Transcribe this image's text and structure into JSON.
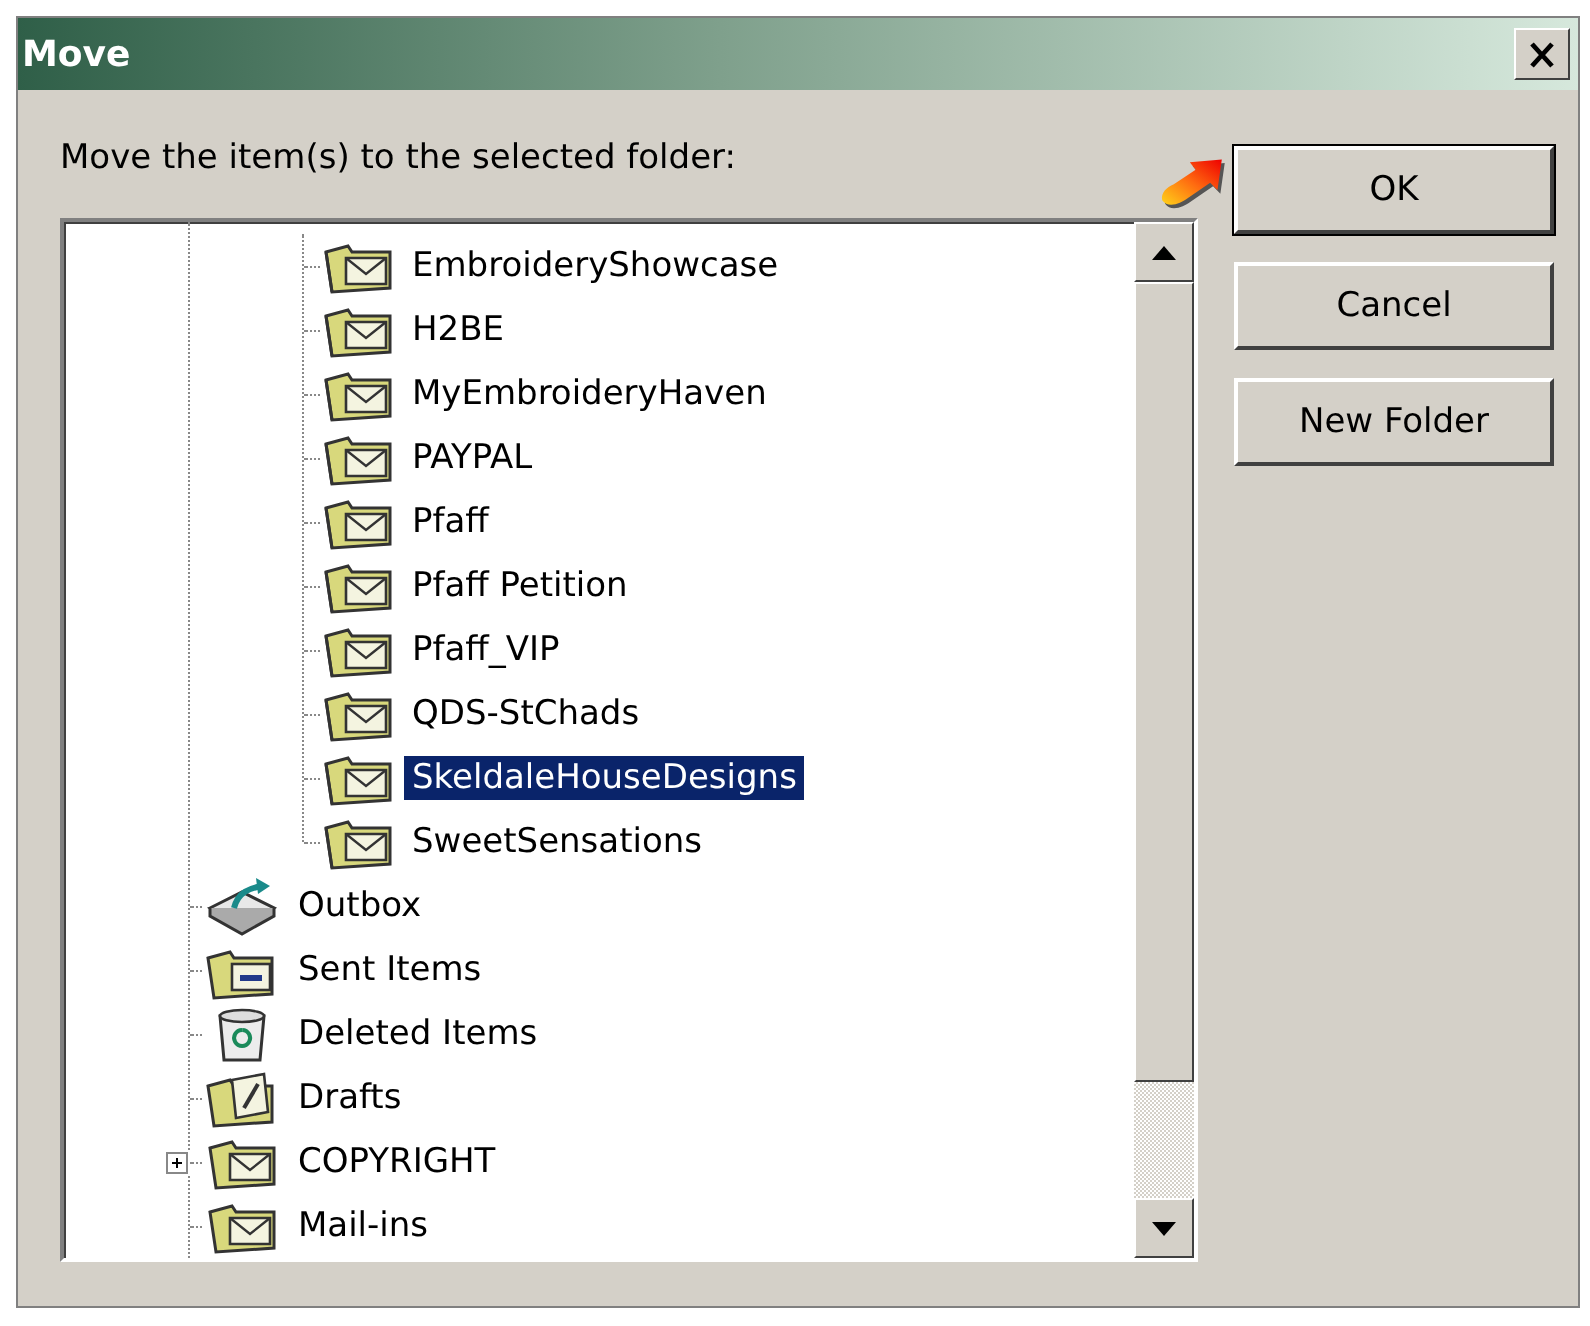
{
  "window": {
    "title": "Move"
  },
  "prompt": "Move the item(s) to the selected folder:",
  "tree": {
    "items": [
      {
        "children": [
          {
            "label": "EmbroideryShowcase",
            "kind": "folder",
            "selected": false
          },
          {
            "label": "H2BE",
            "kind": "folder",
            "selected": false
          },
          {
            "label": "MyEmbroideryHaven",
            "kind": "folder",
            "selected": false
          },
          {
            "label": "PAYPAL",
            "kind": "folder",
            "selected": false
          },
          {
            "label": "Pfaff",
            "kind": "folder",
            "selected": false
          },
          {
            "label": "Pfaff Petition",
            "kind": "folder",
            "selected": false
          },
          {
            "label": "Pfaff_VIP",
            "kind": "folder",
            "selected": false
          },
          {
            "label": "QDS-StChads",
            "kind": "folder",
            "selected": false
          },
          {
            "label": "SkeldaleHouseDesigns",
            "kind": "folder",
            "selected": true
          },
          {
            "label": "SweetSensations",
            "kind": "folder",
            "selected": false
          }
        ]
      },
      {
        "label": "Outbox",
        "kind": "outbox",
        "selected": false,
        "expandable": false
      },
      {
        "label": "Sent Items",
        "kind": "sent",
        "selected": false,
        "expandable": false
      },
      {
        "label": "Deleted Items",
        "kind": "trash",
        "selected": false,
        "expandable": false
      },
      {
        "label": "Drafts",
        "kind": "drafts",
        "selected": false,
        "expandable": false
      },
      {
        "label": "COPYRIGHT",
        "kind": "folder",
        "selected": false,
        "expandable": true
      },
      {
        "label": "Mail-ins",
        "kind": "folder",
        "selected": false,
        "expandable": false
      }
    ]
  },
  "buttons": [
    {
      "label": "OK",
      "default": true
    },
    {
      "label": "Cancel",
      "default": false
    },
    {
      "label": "New Folder",
      "default": false
    }
  ]
}
